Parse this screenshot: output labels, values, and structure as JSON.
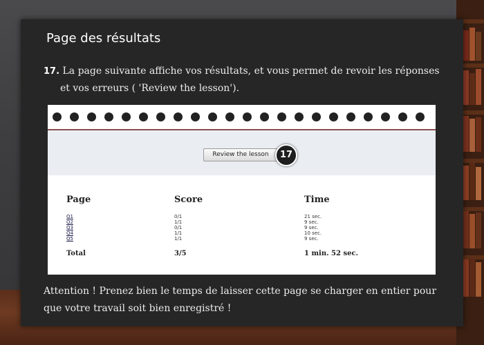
{
  "panel": {
    "title": "Page des résultats",
    "step_number": "17.",
    "step_line1": "La page suivante affiche vos résultats, et vous permet de revoir les réponses",
    "step_line2": "et vos erreurs ( 'Review the lesson').",
    "attention_line1": "Attention ! Prenez bien le temps de laisser cette page se charger en entier pour",
    "attention_line2": "que votre travail soit bien enregistré !"
  },
  "screenshot": {
    "review_button": "Review the lesson",
    "badge": "17",
    "headers": {
      "page": "Page",
      "score": "Score",
      "time": "Time"
    },
    "rows": [
      {
        "page": "Q1",
        "score": "0/1",
        "time": "21 sec."
      },
      {
        "page": "Q2",
        "score": "1/1",
        "time": "9 sec."
      },
      {
        "page": "Q3",
        "score": "0/1",
        "time": "9 sec."
      },
      {
        "page": "Q4",
        "score": "1/1",
        "time": "10 sec."
      },
      {
        "page": "Q5",
        "score": "1/1",
        "time": "9 sec."
      }
    ],
    "total": {
      "label": "Total",
      "score": "3/5",
      "time": "1 min. 52 sec."
    }
  },
  "colors": {
    "panel_bg": "#262626",
    "ring_color": "#222222",
    "divider": "#8a4d4d",
    "review_area_bg": "#eaedf2"
  }
}
